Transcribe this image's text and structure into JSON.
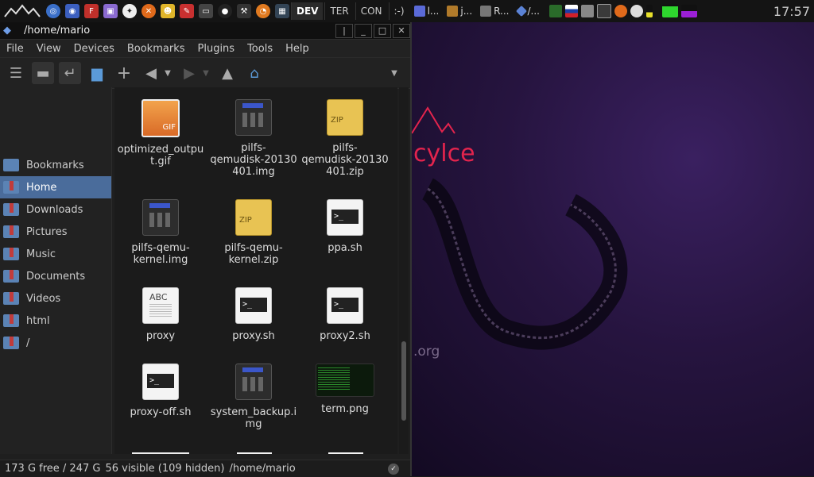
{
  "panel": {
    "workspaces": [
      "DEV",
      "TER",
      "CON",
      ":-)"
    ],
    "active_workspace": "DEV",
    "tasks": [
      "l...",
      "j...",
      "R...",
      "/..."
    ],
    "clock": "17:57"
  },
  "window": {
    "title": "/home/mario"
  },
  "menu": [
    "File",
    "View",
    "Devices",
    "Bookmarks",
    "Plugins",
    "Tools",
    "Help"
  ],
  "sidebar": {
    "items": [
      {
        "label": "Bookmarks"
      },
      {
        "label": "Home"
      },
      {
        "label": "Downloads"
      },
      {
        "label": "Pictures"
      },
      {
        "label": "Music"
      },
      {
        "label": "Documents"
      },
      {
        "label": "Videos"
      },
      {
        "label": "html"
      },
      {
        "label": "/"
      }
    ],
    "active": "Home"
  },
  "files": [
    {
      "name": "optimized_output.gif",
      "lines": [
        "optimized_outpu",
        "t.gif"
      ],
      "type": "gif"
    },
    {
      "name": "pilfs-qemudisk-20130401.img",
      "lines": [
        "pilfs-",
        "qemudisk-20130",
        "401.img"
      ],
      "type": "img"
    },
    {
      "name": "pilfs-qemudisk-20130401.zip",
      "lines": [
        "pilfs-",
        "qemudisk-20130",
        "401.zip"
      ],
      "type": "zip"
    },
    {
      "name": "pilfs-qemu-kernel.img",
      "lines": [
        "pilfs-qemu-",
        "kernel.img"
      ],
      "type": "img"
    },
    {
      "name": "pilfs-qemu-kernel.zip",
      "lines": [
        "pilfs-qemu-",
        "kernel.zip"
      ],
      "type": "zip"
    },
    {
      "name": "ppa.sh",
      "lines": [
        "ppa.sh"
      ],
      "type": "sh"
    },
    {
      "name": "proxy",
      "lines": [
        "proxy"
      ],
      "type": "txt"
    },
    {
      "name": "proxy.sh",
      "lines": [
        "proxy.sh"
      ],
      "type": "sh"
    },
    {
      "name": "proxy2.sh",
      "lines": [
        "proxy2.sh"
      ],
      "type": "sh"
    },
    {
      "name": "proxy-off.sh",
      "lines": [
        "proxy-off.sh"
      ],
      "type": "sh"
    },
    {
      "name": "system_backup.img",
      "lines": [
        "system_backup.i",
        "mg"
      ],
      "type": "img"
    },
    {
      "name": "term.png",
      "lines": [
        "term.png"
      ],
      "type": "png"
    }
  ],
  "status": {
    "free": "173 G free / 247 G",
    "visible": "56 visible (109 hidden)",
    "path": "/home/mario"
  },
  "wallpaper": {
    "text": "cylce",
    "org": ".org"
  },
  "colors": {
    "selection": "#4a6c9b",
    "wall_accent": "#e3244d"
  }
}
